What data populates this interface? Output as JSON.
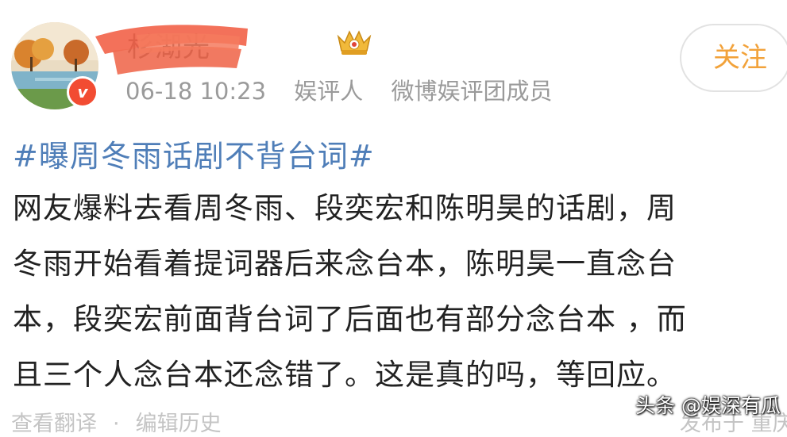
{
  "post": {
    "author": {
      "name": "杉湖光",
      "avatar_icon": "landscape-avatar-icon",
      "verified_badge": "v",
      "badge_icon": "crown-badge-icon"
    },
    "meta": {
      "timestamp": "06-18 10:23",
      "role": "娱评人",
      "group": "微博娱评团成员"
    },
    "follow_label": "关注",
    "hashtag": "#曝周冬雨话剧不背台词#",
    "body_lines": [
      "网友爆料去看周冬雨、段奕宏和陈明昊的话剧，周",
      "冬雨开始看着提词器后来念台本，陈明昊一直念台",
      "本，段奕宏前面背台词了后面也有部分念台本 ，而",
      "且三个人念台本还念错了。这是真的吗，等回应。"
    ],
    "footer": {
      "translate_label": "查看翻译",
      "separator": "·",
      "edit_history_label": "编辑历史",
      "right_text": "发布于 重庆"
    }
  },
  "watermark": "头条 @娱深有瓜",
  "colors": {
    "hashtag": "#4f7eb8",
    "follow": "#f2a23a",
    "meta": "#9a9a9a",
    "verified": "#f24c32",
    "redaction": "#f2654c"
  }
}
